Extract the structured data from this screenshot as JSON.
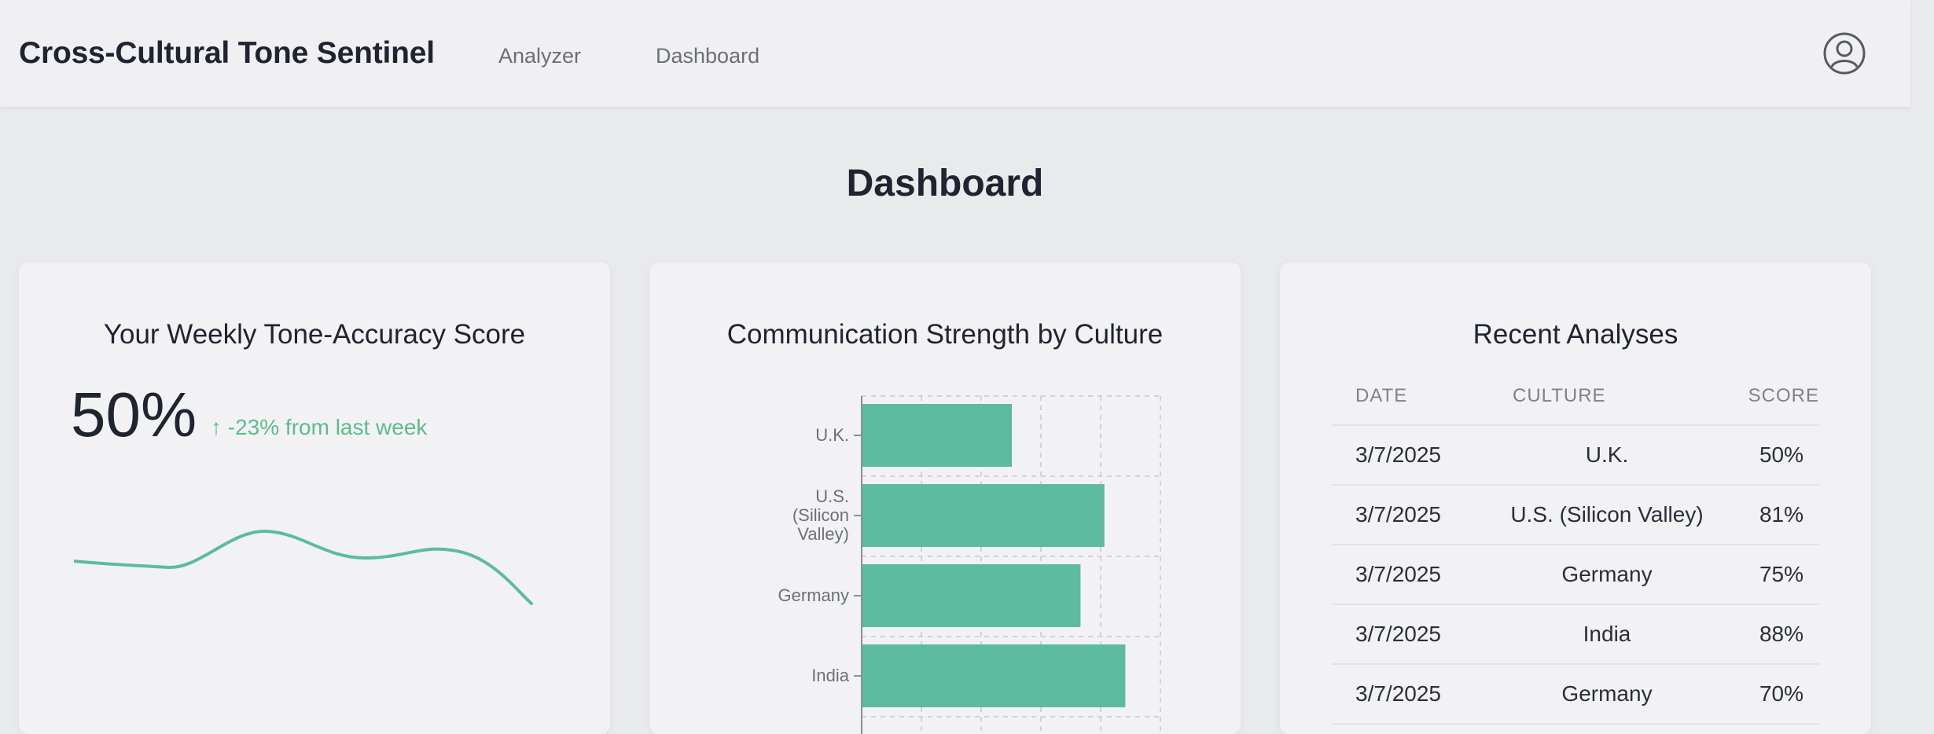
{
  "app": {
    "title": "Cross-Cultural Tone Sentinel",
    "nav": [
      "Analyzer",
      "Dashboard"
    ]
  },
  "page": {
    "title": "Dashboard"
  },
  "score_card": {
    "title": "Your Weekly Tone-Accuracy Score",
    "score": "50%",
    "change": "↑ -23% from last week",
    "trend_color": "#5dbb9f"
  },
  "strength_card": {
    "title": "Communication Strength by Culture"
  },
  "chart_data": {
    "type": "bar",
    "orientation": "horizontal",
    "categories": [
      "U.K.",
      "U.S. (Silicon Valley)",
      "Germany",
      "India"
    ],
    "values": [
      50,
      81,
      73,
      88
    ],
    "xlim": [
      0,
      100
    ],
    "grid": true,
    "bar_color": "#5dbb9f"
  },
  "recent_card": {
    "title": "Recent Analyses",
    "columns": [
      "DATE",
      "CULTURE",
      "SCORE"
    ],
    "rows": [
      {
        "date": "3/7/2025",
        "culture": "U.K.",
        "score": "50%"
      },
      {
        "date": "3/7/2025",
        "culture": "U.S. (Silicon Valley)",
        "score": "81%"
      },
      {
        "date": "3/7/2025",
        "culture": "Germany",
        "score": "75%"
      },
      {
        "date": "3/7/2025",
        "culture": "India",
        "score": "88%"
      },
      {
        "date": "3/7/2025",
        "culture": "Germany",
        "score": "70%"
      }
    ]
  }
}
